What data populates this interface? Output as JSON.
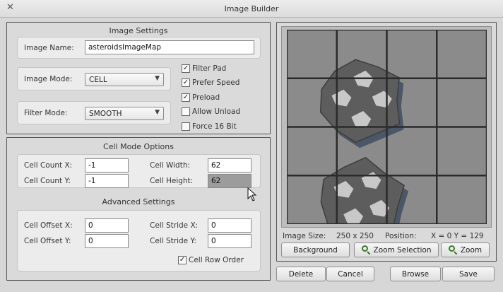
{
  "window": {
    "title": "Image Builder",
    "close_symbol": "✕"
  },
  "image_settings": {
    "title": "Image Settings",
    "image_name_label": "Image Name:",
    "image_name_value": "asteroidsImageMap",
    "image_mode_label": "Image Mode:",
    "image_mode_value": "CELL",
    "filter_mode_label": "Filter Mode:",
    "filter_mode_value": "SMOOTH",
    "checkboxes": [
      {
        "label": "Filter Pad",
        "checked": true
      },
      {
        "label": "Prefer Speed",
        "checked": true
      },
      {
        "label": "Preload",
        "checked": true
      },
      {
        "label": "Allow Unload",
        "checked": false
      },
      {
        "label": "Force 16 Bit",
        "checked": false
      }
    ]
  },
  "cell_mode": {
    "title": "Cell Mode Options",
    "cell_count_x_label": "Cell Count X:",
    "cell_count_x_value": "-1",
    "cell_count_y_label": "Cell Count Y:",
    "cell_count_y_value": "-1",
    "cell_width_label": "Cell Width:",
    "cell_width_value": "62",
    "cell_height_label": "Cell Height:",
    "cell_height_value": "62"
  },
  "advanced": {
    "title": "Advanced Settings",
    "cell_offset_x_label": "Cell Offset X:",
    "cell_offset_x_value": "0",
    "cell_offset_y_label": "Cell Offset Y:",
    "cell_offset_y_value": "0",
    "cell_stride_x_label": "Cell Stride X:",
    "cell_stride_x_value": "0",
    "cell_stride_y_label": "Cell Stride Y:",
    "cell_stride_y_value": "0",
    "row_order_label": "Cell Row Order",
    "row_order_checked": true
  },
  "preview": {
    "image_size_label": "Image Size:",
    "image_size_value": "250 x 250",
    "position_label": "Position:",
    "position_value": "X = 0 Y = 129",
    "background_button": "Background",
    "zoom_selection_button": "Zoom Selection",
    "zoom_button": "Zoom",
    "colors": {
      "rock_dark": "#5d5d5d",
      "rock_light": "#c8c8c8",
      "shadow": "#4a5766",
      "grid": "#2b2b2b"
    }
  },
  "footer": {
    "delete_button": "Delete",
    "cancel_button": "Cancel",
    "browse_button": "Browse",
    "save_button": "Save"
  }
}
